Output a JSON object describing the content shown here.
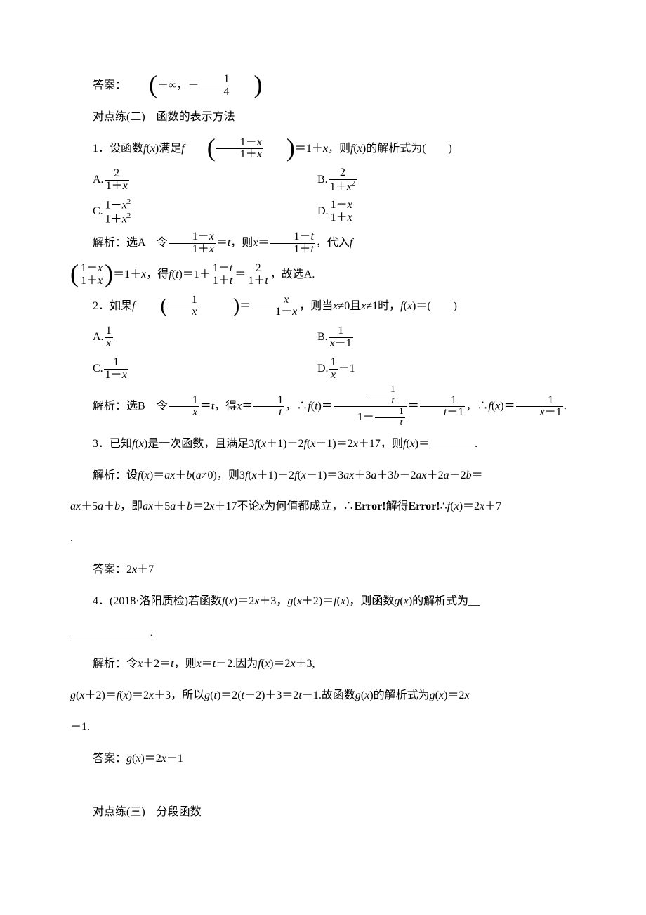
{
  "answer0_label": "答案：",
  "answer0_open": "(",
  "answer0_neg_inf": "－∞，",
  "answer0_neg": "－",
  "answer0_frac_num": "1",
  "answer0_frac_den": "4",
  "answer0_close": ")",
  "section2_title": "对点练(二)　函数的表示方法",
  "q1_pre": "1．设函数",
  "q1_fx": "f",
  "q1_openp": "(",
  "q1_x": "x",
  "q1_closep": ")",
  "q1_satisfy": "满足",
  "q1_f2": "f",
  "q1_frac1_num": "1－x",
  "q1_frac1_den": "1＋x",
  "q1_eq": "＝1＋",
  "q1_xx": "x",
  "q1_then": "，则",
  "q1_fx2": "f",
  "q1_x2": "x",
  "q1_forml": "的解析式为(　　)",
  "q1_A_label": "A.",
  "q1_A_num": "2",
  "q1_A_den": "1＋x",
  "q1_B_label": "B.",
  "q1_B_num": "2",
  "q1_B_den": "1＋x²",
  "q1_C_label": "C.",
  "q1_C_num": "1－x²",
  "q1_C_den": "1＋x²",
  "q1_D_label": "D.",
  "q1_D_num": "1－x",
  "q1_D_den": "1＋x",
  "q1_sol_pre": "解析：选A　令",
  "q1_sol_f1_num": "1－x",
  "q1_sol_f1_den": "1＋x",
  "q1_sol_eqt": "＝",
  "q1_sol_t": "t",
  "q1_sol_then": "，则",
  "q1_sol_xeq": "x",
  "q1_sol_eq2": "＝",
  "q1_sol_f2_num": "1－t",
  "q1_sol_f2_den": "1＋t",
  "q1_sol_sub": "，代入",
  "q1_sol_f": "f",
  "q1_sol2_f1_num": "1－x",
  "q1_sol2_f1_den": "1＋x",
  "q1_sol2_eq": "＝1＋",
  "q1_sol2_x": "x",
  "q1_sol2_get": "，得",
  "q1_sol2_ft": "f",
  "q1_sol2_op": "(",
  "q1_sol2_t": "t",
  "q1_sol2_cp": ")",
  "q1_sol2_eq2": "＝1＋",
  "q1_sol2_f2_num": "1－t",
  "q1_sol2_f2_den": "1＋t",
  "q1_sol2_eq3": "＝",
  "q1_sol2_f3_num": "2",
  "q1_sol2_f3_den": "1＋t",
  "q1_sol2_end": "，故选A.",
  "q2_pre": "2．如果",
  "q2_f": "f",
  "q2_f_num": "1",
  "q2_f_den": "x",
  "q2_eq": "＝",
  "q2_rhs_num": "x",
  "q2_rhs_den": "1－x",
  "q2_cond": "，则当",
  "q2_xne0": "x",
  "q2_ne0": "≠0且",
  "q2_x2": "x",
  "q2_ne1": "≠1时，",
  "q2_fx": "f",
  "q2_op": "(",
  "q2_x3": "x",
  "q2_cp": ")",
  "q2_eq2": "＝(　　)",
  "q2_A_label": "A.",
  "q2_A_num": "1",
  "q2_A_den": "x",
  "q2_B_label": "B.",
  "q2_B_num": "1",
  "q2_B_den": "x－1",
  "q2_C_label": "C.",
  "q2_C_num": "1",
  "q2_C_den": "1－x",
  "q2_D_label": "D.",
  "q2_D_num": "1",
  "q2_D_den": "x",
  "q2_D_minus1": "－1",
  "q2_sol_pre": "解析：选B　令",
  "q2_sol_f1_num": "1",
  "q2_sol_f1_den": "x",
  "q2_sol_eqt": "＝",
  "q2_sol_t": "t",
  "q2_sol_get": "，得",
  "q2_sol_xeq": "x",
  "q2_sol_eq2": "＝",
  "q2_sol_f2_num": "1",
  "q2_sol_f2_den": "t",
  "q2_sol_so": "，∴",
  "q2_sol_ft": "f",
  "q2_sol_op": "(",
  "q2_sol_tt": "t",
  "q2_sol_cp": ")",
  "q2_sol_eq3": "＝",
  "q2_sol_big_num_num": "1",
  "q2_sol_big_num_den": "t",
  "q2_sol_big_den_pre": "1－",
  "q2_sol_big_den_num": "1",
  "q2_sol_big_den_den": "t",
  "q2_sol_eq4": "＝",
  "q2_sol_f4_num": "1",
  "q2_sol_f4_den": "t－1",
  "q2_sol_so2": "，∴",
  "q2_sol_fx": "f",
  "q2_sol_op2": "(",
  "q2_sol_x": "x",
  "q2_sol_cp2": ")",
  "q2_sol_eq5": "＝",
  "q2_sol_f5_num": "1",
  "q2_sol_f5_den": "x－1",
  "q2_sol_dot": ".",
  "q3_text_a": "3．已知",
  "q3_fx": "f",
  "q3_op": "(",
  "q3_x": "x",
  "q3_cp": ")",
  "q3_text_b": "是一次函数，且满足3",
  "q3_fx2": "f",
  "q3_op2": "(",
  "q3_x2": "x",
  "q3_p1": "＋1",
  "q3_cp2": ")",
  "q3_minus": "－2",
  "q3_fx3": "f",
  "q3_op3": "(",
  "q3_x3": "x",
  "q3_m1": "－1",
  "q3_cp3": ")",
  "q3_eq": "＝2",
  "q3_x4": "x",
  "q3_p17": "＋17，则",
  "q3_fx4": "f",
  "q3_op4": "(",
  "q3_x5": "x",
  "q3_cp4": ")",
  "q3_eq2": "＝________.",
  "q3_sol_a": "a",
  "q3_sol_fx": "f",
  "q3_sol_op": "(",
  "q3_sol_x": "x",
  "q3_sol_cp": ")",
  "q3_sol_eq": "＝",
  "q3_sol_ax": "ax",
  "q3_sol_pb": "＋",
  "q3_sol_b": "b",
  "q3_sol_op2": "(",
  "q3_sol_ne": "≠0",
  "q3_sol_cp2": ")",
  "q3_sol_then": "，则3",
  "q3_sol_fx2": "f",
  "q3_sol_op3": "(",
  "q3_sol_x2": "x",
  "q3_sol_p1": "＋1",
  "q3_sol_cp3": ")",
  "q3_sol_m2": "－2",
  "q3_sol_fx3": "f",
  "q3_sol_op4": "(",
  "q3_sol_x3": "x",
  "q3_sol_m1": "－1",
  "q3_sol_cp4": ")",
  "q3_sol_eq2": "＝3",
  "q3_sol_ax2": "ax",
  "q3_sol_p3a": "＋3",
  "q3_sol_aa": "a",
  "q3_sol_p3b": "＋3",
  "q3_sol_bb": "b",
  "q3_sol_m2a": "－2",
  "q3_sol_ax3": "ax",
  "q3_sol_p2a": "＋2",
  "q3_sol_aaa": "a",
  "q3_sol_m2b": "－2",
  "q3_sol_bbb": "b",
  "q3_sol_eq3": "＝",
  "q3_sol_line2_a": "ax",
  "q3_sol_line2_p5a": "＋5",
  "q3_sol_line2_aa": "a",
  "q3_sol_line2_pb": "＋",
  "q3_sol_line2_b": "b",
  "q3_sol_line2_ji": "，即",
  "q3_sol_line2_ax": "ax",
  "q3_sol_line2_p5a2": "＋5",
  "q3_sol_line2_a2": "a",
  "q3_sol_line2_pb2": "＋",
  "q3_sol_line2_b2": "b",
  "q3_sol_line2_eq": "＝2",
  "q3_sol_line2_x": "x",
  "q3_sol_line2_p17": "＋17不论",
  "q3_sol_line2_x2": "x",
  "q3_sol_line2_rest": "为何值都成立，∴",
  "q3_sol_line2_err1": "Error!",
  "q3_sol_line2_solve": "解得",
  "q3_sol_line2_err2": "Error!",
  "q3_sol_line2_so": "∴",
  "q3_sol_line2_fx": "f",
  "q3_sol_line2_op": "(",
  "q3_sol_line2_xx": "x",
  "q3_sol_line2_cp": ")",
  "q3_sol_line2_eq2": "＝2",
  "q3_sol_line2_xxx": "x",
  "q3_sol_line2_p7": "＋7",
  "q3_sol_dot": ".",
  "q3_ans": "答案：2",
  "q3_ans_x": "x",
  "q3_ans_p7": "＋7",
  "q4_pre": "4．(2018·洛阳质检)若函数",
  "q4_fx": "f",
  "q4_op": "(",
  "q4_x": "x",
  "q4_cp": ")",
  "q4_eq": "＝2",
  "q4_x2": "x",
  "q4_p3": "＋3，",
  "q4_gx": "g",
  "q4_op2": "(",
  "q4_x3": "x",
  "q4_p2": "＋2",
  "q4_cp2": ")",
  "q4_eq2": "＝",
  "q4_fx2": "f",
  "q4_op3": "(",
  "q4_x4": "x",
  "q4_cp3": ")",
  "q4_then": "，则函数",
  "q4_gx2": "g",
  "q4_op4": "(",
  "q4_x5": "x",
  "q4_cp4": ")",
  "q4_text": "的解析式为__",
  "q4_blank": "______________．",
  "q4_sol_a": "解析：令",
  "q4_sol_x": "x",
  "q4_sol_p2": "＋2＝",
  "q4_sol_t": "t",
  "q4_sol_then": "，则",
  "q4_sol_x2": "x",
  "q4_sol_eq": "＝",
  "q4_sol_t2": "t",
  "q4_sol_m2": "－2.因为",
  "q4_sol_fx": "f",
  "q4_sol_op": "(",
  "q4_sol_x3": "x",
  "q4_sol_cp": ")",
  "q4_sol_eq2": "＝2",
  "q4_sol_x4": "x",
  "q4_sol_p3": "＋3,",
  "q4_sol2_gx": "g",
  "q4_sol2_op": "(",
  "q4_sol2_x": "x",
  "q4_sol2_p2": "＋2",
  "q4_sol2_cp": ")",
  "q4_sol2_eq": "＝",
  "q4_sol2_fx": "f",
  "q4_sol2_op2": "(",
  "q4_sol2_x2": "x",
  "q4_sol2_cp2": ")",
  "q4_sol2_eq2": "＝2",
  "q4_sol2_x3": "x",
  "q4_sol2_p3": "＋3，所以",
  "q4_sol2_gt": "g",
  "q4_sol2_op3": "(",
  "q4_sol2_t": "t",
  "q4_sol2_cp3": ")",
  "q4_sol2_eq3": "＝2(",
  "q4_sol2_t2": "t",
  "q4_sol2_m2": "－2)＋3＝2",
  "q4_sol2_t3": "t",
  "q4_sol2_m1": "－1.故函数",
  "q4_sol2_gx2": "g",
  "q4_sol2_op4": "(",
  "q4_sol2_x4": "x",
  "q4_sol2_cp4": ")",
  "q4_sol2_text": "的解析式为",
  "q4_sol2_gx3": "g",
  "q4_sol2_op5": "(",
  "q4_sol2_x5": "x",
  "q4_sol2_cp5": ")",
  "q4_sol2_eq4": "＝2",
  "q4_sol2_x6": "x",
  "q4_sol3": "－1.",
  "q4_ans_pre": "答案：",
  "q4_ans_g": "g",
  "q4_ans_op": "(",
  "q4_ans_x": "x",
  "q4_ans_cp": ")",
  "q4_ans_eq": "＝2",
  "q4_ans_x2": "x",
  "q4_ans_m1": "－1",
  "section3_title": "对点练(三)　分段函数"
}
